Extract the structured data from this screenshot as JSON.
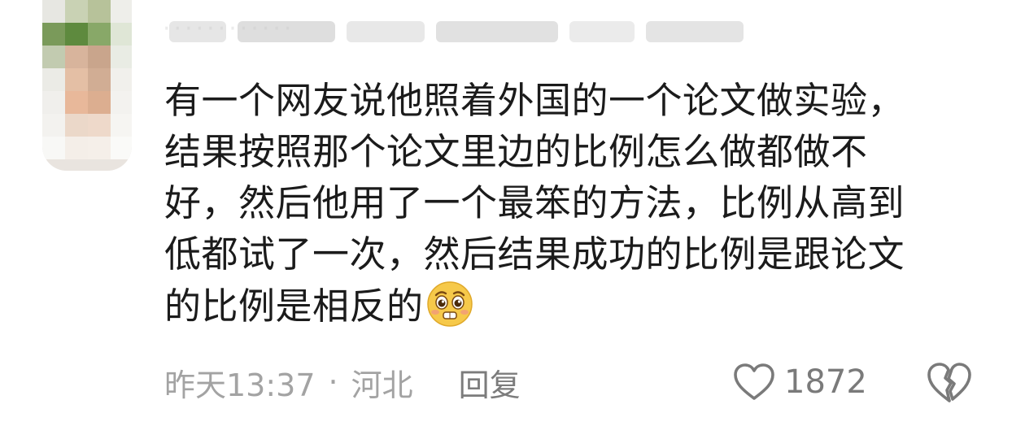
{
  "comment": {
    "author_name": "············",
    "lines": [
      "有一个网友说他照着外国的一个论文做实验，",
      "结果按照那个论文里边的比例怎么做都做不",
      "好，然后他用了一个最笨的方法，比例从高到",
      "低都试了一次，然后结果成功的比例是跟论文",
      "的比例是相反的"
    ],
    "emoji_icon": "pleading-face-emoji-icon",
    "time": "昨天13:37",
    "separator": "·",
    "location": "河北",
    "reply_label": "回复",
    "like_count": "1872",
    "like_icon": "heart-outline-icon",
    "dislike_icon": "broken-heart-icon"
  },
  "colors": {
    "text": "#1b1b1b",
    "meta": "#a3a3a3",
    "icon": "#7a7a7a",
    "emoji_face": "#f6c94a"
  }
}
